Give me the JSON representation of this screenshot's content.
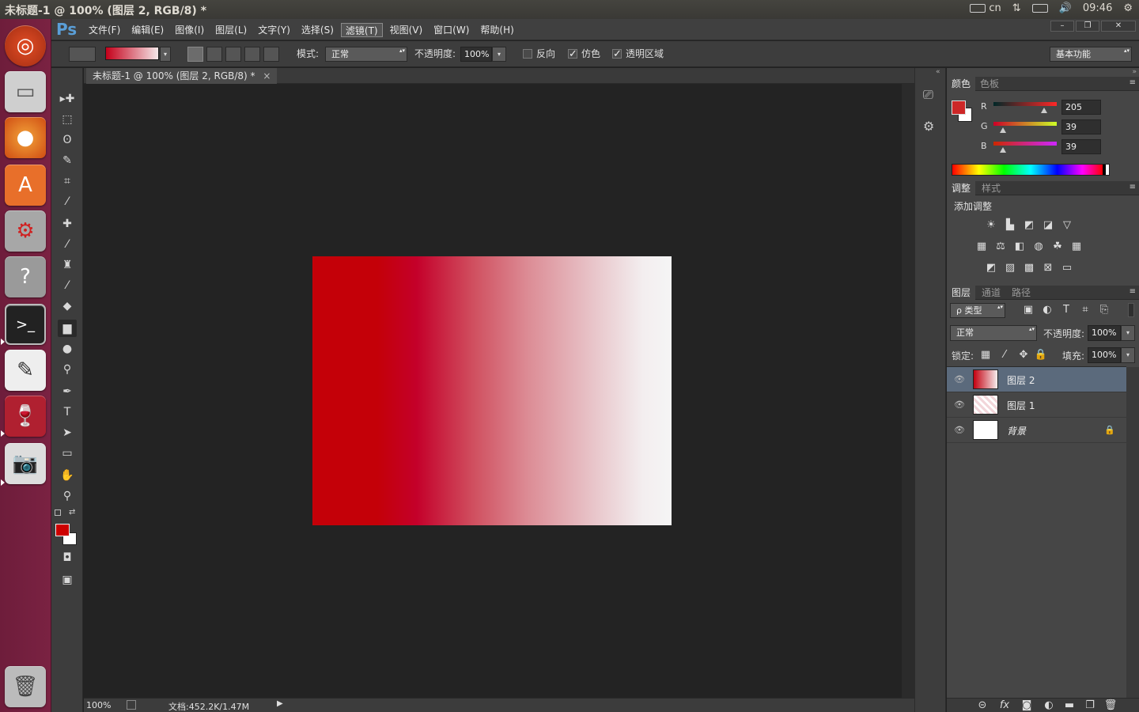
{
  "topbar": {
    "window_title": "未标题-1 @ 100% (图层 2, RGB/8) *",
    "keyboard": "cn",
    "time": "09:46"
  },
  "menubar": {
    "logo": "Ps",
    "menus": [
      "文件(F)",
      "编辑(E)",
      "图像(I)",
      "图层(L)",
      "文字(Y)",
      "选择(S)",
      "滤镜(T)",
      "视图(V)",
      "窗口(W)",
      "帮助(H)"
    ],
    "active_menu": "滤镜(T)"
  },
  "options": {
    "mode_label": "模式:",
    "mode_value": "正常",
    "opacity_label": "不透明度:",
    "opacity_value": "100%",
    "reverse_label": "反向",
    "reverse_checked": false,
    "dither_label": "仿色",
    "dither_checked": true,
    "transparency_label": "透明区域",
    "transparency_checked": true,
    "workspace": "基本功能"
  },
  "document": {
    "tab_title": "未标题-1 @ 100% (图层 2, RGB/8) *",
    "zoom": "100%",
    "doc_info": "文档:452.2K/1.47M"
  },
  "color_panel": {
    "tabs": [
      "颜色",
      "色板"
    ],
    "foreground": "#CD2727",
    "background": "#FFFFFF",
    "channels": [
      {
        "label": "R",
        "value": "205"
      },
      {
        "label": "G",
        "value": "39"
      },
      {
        "label": "B",
        "value": "39"
      }
    ]
  },
  "adjustments_panel": {
    "tabs": [
      "调整",
      "样式"
    ],
    "heading": "添加调整"
  },
  "layers_panel": {
    "tabs": [
      "图层",
      "通道",
      "路径"
    ],
    "filter_label": "ρ 类型",
    "blend_mode": "正常",
    "opacity_label": "不透明度:",
    "opacity_value": "100%",
    "lock_label": "锁定:",
    "fill_label": "填充:",
    "fill_value": "100%",
    "layers": [
      {
        "name": "图层 2",
        "selected": true
      },
      {
        "name": "图层 1",
        "selected": false
      },
      {
        "name": "背景",
        "selected": false,
        "locked": true
      }
    ]
  },
  "colors": {
    "launcher_bg": "#77203F",
    "app_bg": "#222222",
    "selected_layer": "#5B6A7C"
  }
}
